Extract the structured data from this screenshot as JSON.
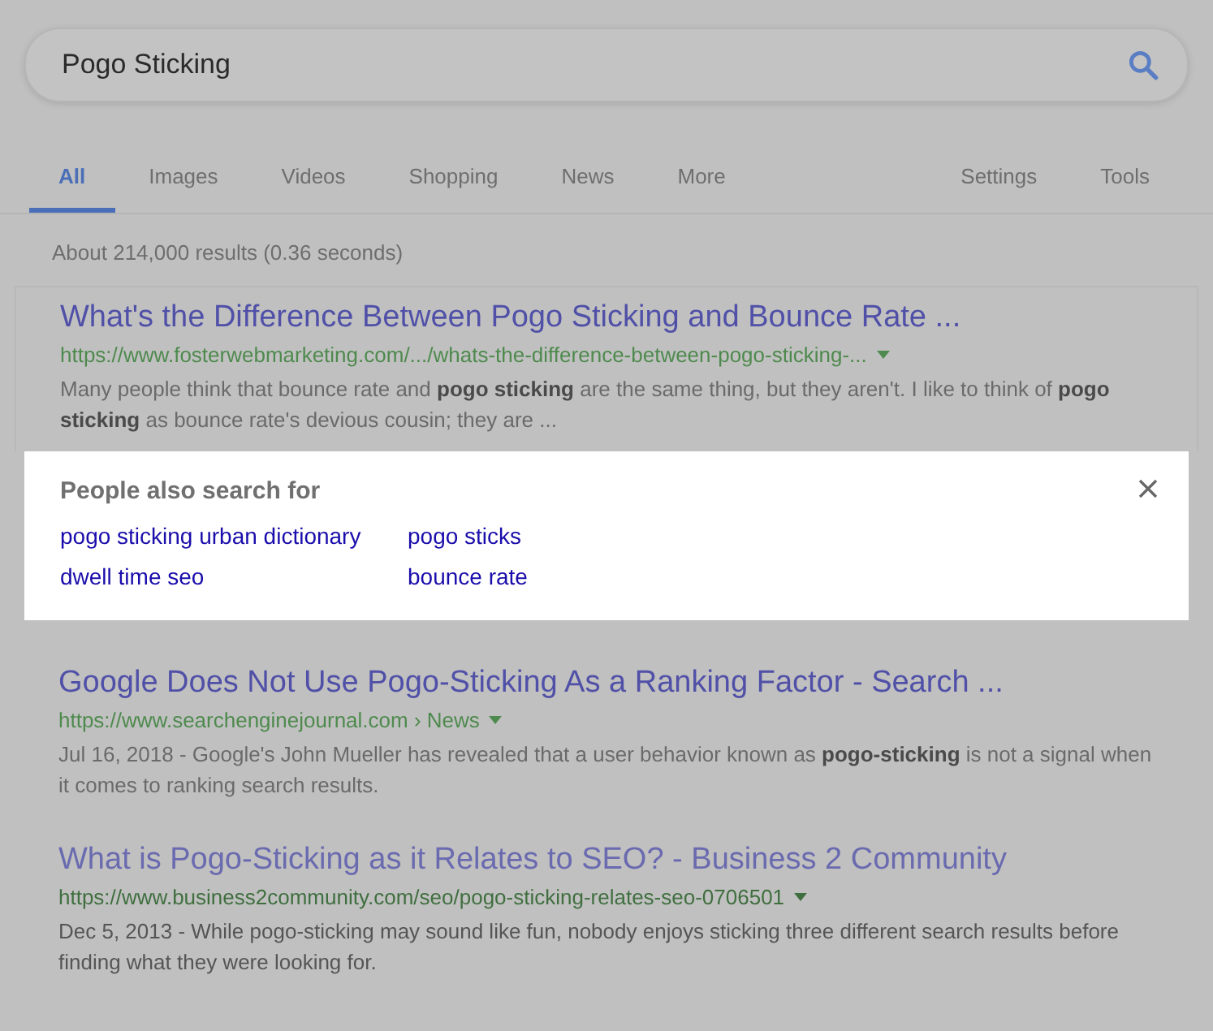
{
  "search": {
    "value": "Pogo Sticking"
  },
  "tabs": [
    {
      "label": "All",
      "selected": true
    },
    {
      "label": "Images",
      "selected": false
    },
    {
      "label": "Videos",
      "selected": false
    },
    {
      "label": "Shopping",
      "selected": false
    },
    {
      "label": "News",
      "selected": false
    },
    {
      "label": "More",
      "selected": false
    }
  ],
  "tools": [
    "Settings",
    "Tools"
  ],
  "result_stats": "About 214,000 results (0.36 seconds)",
  "results": [
    {
      "title": "What's the Difference Between Pogo Sticking and Bounce Rate ...",
      "url": "https://www.fosterwebmarketing.com/.../whats-the-difference-between-pogo-sticking-...",
      "snippet": "Many people think that bounce rate and **pogo sticking** are the same thing, but they aren't. I like to think of **pogo sticking** as bounce rate's devious cousin; they are ..."
    },
    {
      "title": "Google Does Not Use Pogo-Sticking As a Ranking Factor - Search ...",
      "url": "https://www.searchenginejournal.com › News",
      "snippet": "Jul 16, 2018 - Google's John Mueller has revealed that a user behavior known as **pogo-sticking** is not a signal when it comes to ranking search results."
    },
    {
      "title": "What is Pogo-Sticking as it Relates to SEO? - Business 2 Community",
      "url": "https://www.business2community.com/seo/pogo-sticking-relates-seo-0706501",
      "snippet": "Dec 5, 2013 - While pogo-sticking may sound like fun, nobody enjoys sticking three different search results before finding what they were looking for."
    }
  ],
  "related": {
    "heading": "People also search for",
    "links": [
      "pogo sticking urban dictionary",
      "pogo sticks",
      "dwell time seo",
      "bounce rate"
    ]
  }
}
